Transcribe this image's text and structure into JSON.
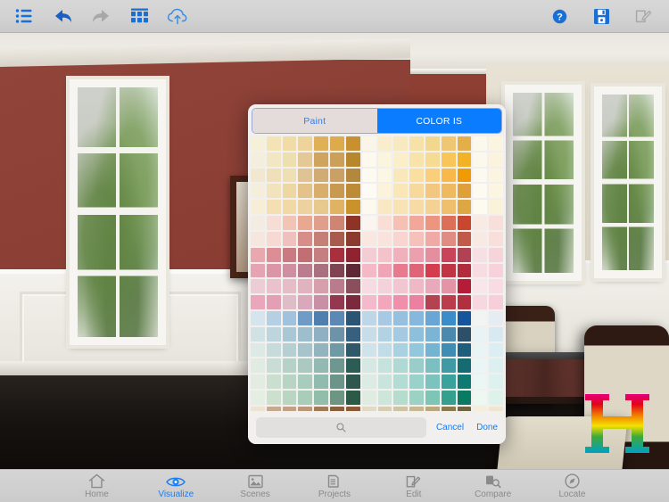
{
  "toolbar": {
    "left_buttons": [
      {
        "name": "list-icon",
        "label": "List",
        "color": "#1a6fd4",
        "enabled": true
      },
      {
        "name": "undo-icon",
        "label": "Undo",
        "color": "#1a5fc4",
        "enabled": true
      },
      {
        "name": "redo-icon",
        "label": "Redo",
        "color": "#a8a8a8",
        "enabled": false
      },
      {
        "name": "grid-icon",
        "label": "Palette Grid",
        "color": "#1a6fd4",
        "enabled": true
      },
      {
        "name": "cloud-upload-icon",
        "label": "Upload",
        "color": "#3f8de0",
        "enabled": true
      }
    ],
    "right_buttons": [
      {
        "name": "help-icon",
        "label": "Help",
        "color": "#1a6fd4",
        "enabled": true
      },
      {
        "name": "save-icon",
        "label": "Save",
        "color": "#1a6fd4",
        "enabled": true
      },
      {
        "name": "edit-icon",
        "label": "Edit",
        "color": "#a8a8a8",
        "enabled": false
      }
    ]
  },
  "modal": {
    "tabs": [
      {
        "label": "Paint",
        "active": false
      },
      {
        "label": "COLOR IS",
        "active": true
      }
    ],
    "search": {
      "value": "",
      "placeholder": ""
    },
    "cancel_label": "Cancel",
    "done_label": "Done",
    "accent_color": "#0a7cff",
    "grid": {
      "columns": 16,
      "rows": 18,
      "swatches": [
        "#f7f0d9",
        "#f4e3b4",
        "#f0dca4",
        "#eed49a",
        "#e0b057",
        "#ddab4c",
        "#c8902f",
        "#faf5e6",
        "#f9edcd",
        "#f8eac0",
        "#f6e2a6",
        "#f2d78f",
        "#efc671",
        "#e4ae49",
        "#fcf8ec",
        "#faf4e1",
        "#f4eedd",
        "#f2e6c3",
        "#eedfae",
        "#e4c895",
        "#cfa45f",
        "#cda05a",
        "#b8872c",
        "#fdf9ef",
        "#fbf4de",
        "#faefc9",
        "#f8e4ab",
        "#f6db92",
        "#f7c558",
        "#f1b223",
        "#fcf8ec",
        "#fbf3dd",
        "#f2e7cf",
        "#f0e0b9",
        "#eedfb5",
        "#dfc394",
        "#d1ab74",
        "#cba064",
        "#b3873c",
        "#fdfaf1",
        "#fcf6e4",
        "#fbe8ba",
        "#fadfa0",
        "#f9cf7a",
        "#f8b94a",
        "#f09a06",
        "#fcf9f0",
        "#fbf4e0",
        "#f6eedc",
        "#f3e3bd",
        "#edd8a4",
        "#e3c389",
        "#d8ae6c",
        "#c89a4f",
        "#bd8b33",
        "#fdfbf4",
        "#fbf3da",
        "#f9e7b8",
        "#f7d99c",
        "#f3c77d",
        "#efb95f",
        "#dfa03a",
        "#fdfaf2",
        "#fbf5e2",
        "#f7eed8",
        "#f3dfb2",
        "#f0d9a5",
        "#edd2a0",
        "#e7c88d",
        "#e0b264",
        "#c9922a",
        "#fcf9ef",
        "#f9e8c3",
        "#f8e3b4",
        "#f6dca4",
        "#f4d293",
        "#efbf6e",
        "#dda744",
        "#fdfaf0",
        "#faf2d9",
        "#f3ece3",
        "#f6ddd5",
        "#f2c4b3",
        "#e9a891",
        "#e09e8c",
        "#cf8573",
        "#8e3326",
        "#fbf5f1",
        "#f8ded5",
        "#f6c0b2",
        "#f2a798",
        "#ed9580",
        "#dd6f59",
        "#c9472f",
        "#faeae4",
        "#f9dfd9",
        "#f5e6de",
        "#f5d9d2",
        "#f0c0be",
        "#d78d88",
        "#c47f77",
        "#a85a4c",
        "#8c3a2e",
        "#f8e8e0",
        "#fae2dd",
        "#f8d5d0",
        "#f6c0bb",
        "#f0a9a4",
        "#e08c83",
        "#c25a4a",
        "#f9e9e4",
        "#f8dfda",
        "#e8a8ad",
        "#dc8e94",
        "#cc7a81",
        "#c26f73",
        "#c67f80",
        "#a8303c",
        "#8f2330",
        "#f4ccd4",
        "#f3c2ca",
        "#f0b0bc",
        "#ec9fae",
        "#e48fa0",
        "#c9445b",
        "#b14254",
        "#f7e0e4",
        "#f6d5da",
        "#e6a4b2",
        "#dc95a6",
        "#d08fa0",
        "#bb7d8d",
        "#a9707f",
        "#7f4352",
        "#5e2837",
        "#f4b8c6",
        "#f0a4b6",
        "#e8798f",
        "#e06477",
        "#d53d4f",
        "#c13446",
        "#b12d3c",
        "#f8dce2",
        "#f7d2da",
        "#eccdd5",
        "#e9c2cc",
        "#e6bcc6",
        "#e1b3be",
        "#d79eab",
        "#b87c8c",
        "#8a4e5c",
        "#f6dbe2",
        "#f4d2db",
        "#f2c6d1",
        "#eeb8c6",
        "#e9a9ba",
        "#e593a6",
        "#b41c38",
        "#f9e6ea",
        "#f8dce2",
        "#eaa7bc",
        "#e3a0b4",
        "#debdc7",
        "#d9a8bb",
        "#c98fa4",
        "#93384f",
        "#7b2a3d",
        "#f5b9cc",
        "#f2a7bd",
        "#ef8fa9",
        "#eb80a0",
        "#b44250",
        "#bb3c4c",
        "#b0303f",
        "#f8d8e0",
        "#f7cfd9",
        "#d6e5ed",
        "#b6d0e3",
        "#a0c2dd",
        "#6e9cc6",
        "#4f7fae",
        "#5b88b4",
        "#2b5574",
        "#bdd7e8",
        "#a7c9e3",
        "#96c0e0",
        "#86b7dc",
        "#6aa6d5",
        "#3b8dc9",
        "#14559c",
        "#f1f4f3",
        "#e6edf2",
        "#d1e2e5",
        "#bdd5dd",
        "#a9c7d4",
        "#9fbecd",
        "#8fb0c2",
        "#6e92a8",
        "#36607e",
        "#c7dde9",
        "#b3d2e3",
        "#a3cae0",
        "#8fc0db",
        "#7cb4d6",
        "#4c89ae",
        "#2d4f68",
        "#e9f2f4",
        "#d9e9f1",
        "#dce9e4",
        "#c6dbdb",
        "#b4d0d3",
        "#a5c4cb",
        "#93b4bc",
        "#6f9aa4",
        "#2f596a",
        "#cfe4ea",
        "#bfdce7",
        "#a8d2e2",
        "#92c8de",
        "#72b4d2",
        "#3f8cb4",
        "#1f5f7e",
        "#e9f4f5",
        "#daeef4",
        "#e0ebe2",
        "#c8ddd5",
        "#b5d2c9",
        "#a9c9c1",
        "#93b9b2",
        "#6e988f",
        "#2c5c55",
        "#d6e8e4",
        "#c5e2dd",
        "#b0d8d4",
        "#99cdca",
        "#7bbfc0",
        "#3f9aa4",
        "#166b72",
        "#eaf6f5",
        "#dcf0f2",
        "#e2ece2",
        "#cadfd0",
        "#b7d4c5",
        "#a8ccbd",
        "#92bbb0",
        "#6b9589",
        "#2e574d",
        "#dcebe3",
        "#c8e4dd",
        "#b3dcd5",
        "#99d1cb",
        "#7cc3bf",
        "#3aa29c",
        "#0e7a72",
        "#ebf7f4",
        "#ddf1ef",
        "#e4eee3",
        "#cbe0cd",
        "#b8d6c2",
        "#a8ceb9",
        "#92bdab",
        "#6c9682",
        "#2d5a47",
        "#e0ece2",
        "#cde6d9",
        "#b6dccd",
        "#9cd2c4",
        "#7ec5b6",
        "#35a08d",
        "#0b7a63",
        "#edf8f2",
        "#def2ec",
        "#ece3d2",
        "#c6a98e",
        "#c3a184",
        "#bb9878",
        "#a07b58",
        "#8a5f3c",
        "#8a5a32",
        "#e1dac4",
        "#d6cdb2",
        "#cdc4a4",
        "#c6b992",
        "#baa97c",
        "#8a7a4f",
        "#6f6340",
        "#f4eedb",
        "#eee6cf"
      ]
    }
  },
  "bottom_nav": {
    "items": [
      {
        "label": "Home",
        "icon": "home-icon",
        "active": false
      },
      {
        "label": "Visualize",
        "icon": "eye-icon",
        "active": true
      },
      {
        "label": "Scenes",
        "icon": "image-icon",
        "active": false
      },
      {
        "label": "Projects",
        "icon": "folder-icon",
        "active": false
      },
      {
        "label": "Edit",
        "icon": "pencil-icon",
        "active": false
      },
      {
        "label": "Compare",
        "icon": "compare-icon",
        "active": false
      },
      {
        "label": "Locate",
        "icon": "compass-icon",
        "active": false
      }
    ]
  },
  "watermark": {
    "letter": "H",
    "description": "rainbow-gradient-h-logo"
  }
}
